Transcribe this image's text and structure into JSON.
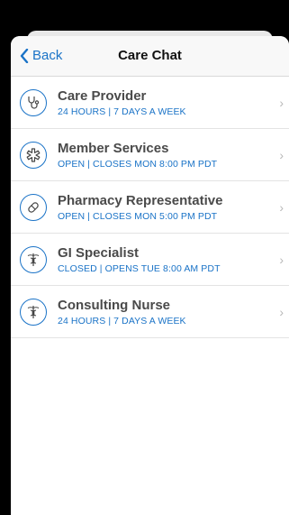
{
  "nav": {
    "back_label": "Back",
    "title": "Care Chat"
  },
  "items": [
    {
      "title": "Care Provider",
      "subtitle": "24 HOURS | 7 DAYS A WEEK",
      "icon": "stethoscope-icon"
    },
    {
      "title": "Member Services",
      "subtitle": "OPEN | CLOSES MON 8:00 PM PDT",
      "icon": "star-of-life-icon"
    },
    {
      "title": "Pharmacy Representative",
      "subtitle": "OPEN | CLOSES MON 5:00 PM PDT",
      "icon": "pill-icon"
    },
    {
      "title": "GI Specialist",
      "subtitle": "CLOSED | OPENS TUE 8:00 AM PDT",
      "icon": "caduceus-icon"
    },
    {
      "title": "Consulting Nurse",
      "subtitle": "24 HOURS | 7 DAYS A WEEK",
      "icon": "caduceus-icon"
    }
  ],
  "colors": {
    "accent": "#1a73c7",
    "title_text": "#4a4a4a",
    "chevron": "#b8b8b8"
  }
}
